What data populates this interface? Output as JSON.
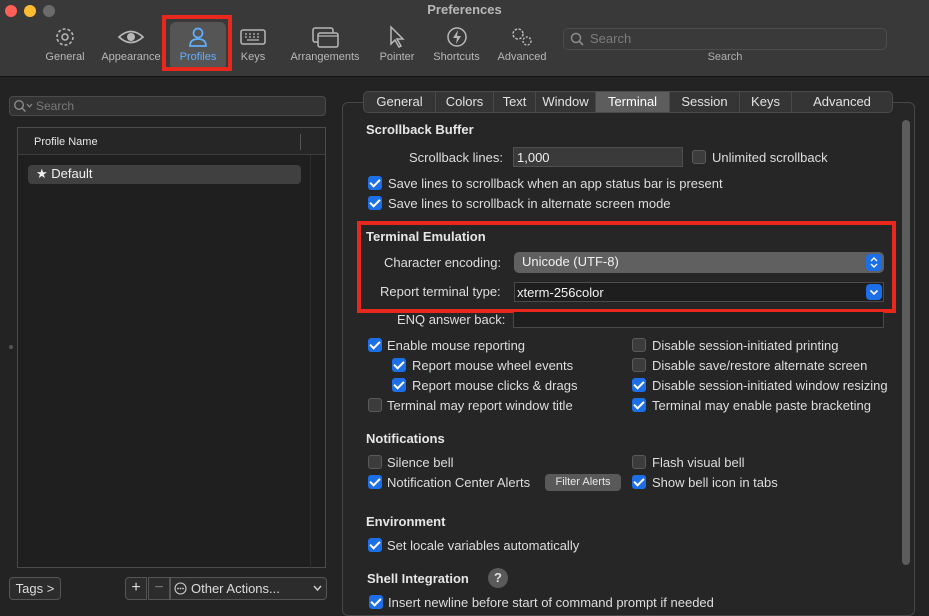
{
  "window": {
    "title": "Preferences"
  },
  "toolbar": {
    "items": [
      {
        "label": "General",
        "icon": "gear-icon"
      },
      {
        "label": "Appearance",
        "icon": "eye-icon"
      },
      {
        "label": "Profiles",
        "icon": "person-icon"
      },
      {
        "label": "Keys",
        "icon": "keyboard-icon"
      },
      {
        "label": "Arrangements",
        "icon": "windows-icon"
      },
      {
        "label": "Pointer",
        "icon": "cursor-icon"
      },
      {
        "label": "Shortcuts",
        "icon": "lightning-icon"
      },
      {
        "label": "Advanced",
        "icon": "gears-icon"
      }
    ],
    "selected": "Profiles",
    "search": {
      "placeholder": "Search",
      "caption": "Search"
    }
  },
  "sidebar": {
    "search_placeholder": "Search",
    "column_header": "Profile Name",
    "profiles": [
      {
        "name": "Default",
        "default": true
      }
    ],
    "tags_button": "Tags >",
    "add_button": "+",
    "remove_button": "−",
    "other_actions": "Other Actions..."
  },
  "tabs": [
    "General",
    "Colors",
    "Text",
    "Window",
    "Terminal",
    "Session",
    "Keys",
    "Advanced"
  ],
  "selected_tab": "Terminal",
  "scrollback": {
    "title": "Scrollback Buffer",
    "lines_label": "Scrollback lines:",
    "lines_value": "1,000",
    "unlimited_label": "Unlimited scrollback",
    "unlimited_checked": false,
    "status_bar_label": "Save lines to scrollback when an app status bar is present",
    "status_bar_checked": true,
    "alt_screen_label": "Save lines to scrollback in alternate screen mode",
    "alt_screen_checked": true
  },
  "emulation": {
    "title": "Terminal Emulation",
    "encoding_label": "Character encoding:",
    "encoding_value": "Unicode (UTF-8)",
    "report_label": "Report terminal type:",
    "report_value": "xterm-256color",
    "enq_label": "ENQ answer back:",
    "enq_value": ""
  },
  "mouse": {
    "left": [
      {
        "label": "Enable mouse reporting",
        "checked": true
      },
      {
        "label": "Report mouse wheel events",
        "checked": true
      },
      {
        "label": "Report mouse clicks & drags",
        "checked": true
      },
      {
        "label": "Terminal may report window title",
        "checked": false
      }
    ],
    "right": [
      {
        "label": "Disable session-initiated printing",
        "checked": false
      },
      {
        "label": "Disable save/restore alternate screen",
        "checked": false
      },
      {
        "label": "Disable session-initiated window resizing",
        "checked": true
      },
      {
        "label": "Terminal may enable paste bracketing",
        "checked": true
      }
    ]
  },
  "notifications": {
    "title": "Notifications",
    "silence_bell": {
      "label": "Silence bell",
      "checked": false
    },
    "flash_bell": {
      "label": "Flash visual bell",
      "checked": false
    },
    "nc_alerts": {
      "label": "Notification Center Alerts",
      "checked": true
    },
    "filter_button": "Filter Alerts",
    "bell_icon": {
      "label": "Show bell icon in tabs",
      "checked": true
    }
  },
  "environment": {
    "title": "Environment",
    "locale": {
      "label": "Set locale variables automatically",
      "checked": true
    }
  },
  "shell": {
    "title": "Shell Integration",
    "help": "?",
    "newline": {
      "label": "Insert newline before start of command prompt if needed",
      "checked": true
    }
  },
  "colors": {
    "accent": "#1d6fe8",
    "highlight": "#e8271d"
  }
}
